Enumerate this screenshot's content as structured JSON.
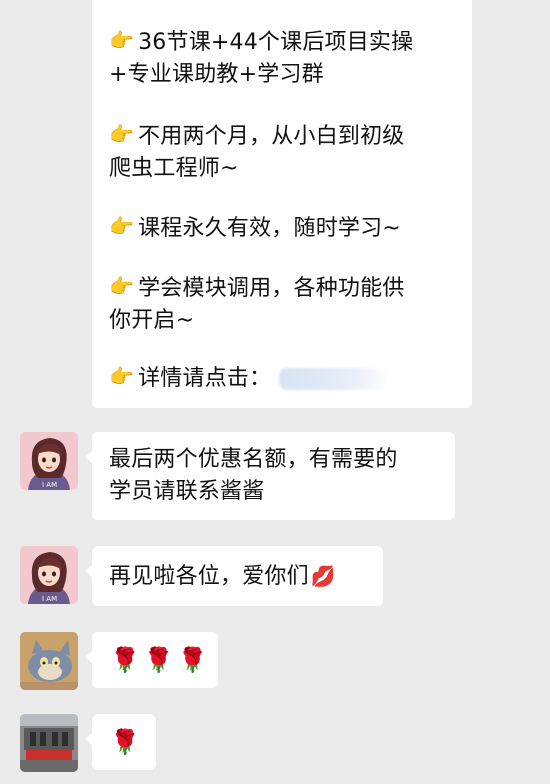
{
  "messages": [
    {
      "sender": "self-truncated",
      "paragraphs": [
        {
          "icon": "👉",
          "lines": [
            "36节课+44个课后项目实操",
            "+专业课助教+学习群"
          ]
        },
        {
          "icon": "👉",
          "lines": [
            "不用两个月，从小白到初级",
            "爬虫工程师~"
          ]
        },
        {
          "icon": "👉",
          "lines": [
            "课程永久有效，随时学习~"
          ]
        },
        {
          "icon": "👉",
          "lines": [
            "学会模块调用，各种功能供",
            "你开启~"
          ]
        },
        {
          "icon": "👉",
          "lines": [
            "详情请点击："
          ]
        }
      ]
    },
    {
      "sender": "anime-avatar",
      "lines": [
        "最后两个优惠名额，有需要的",
        "学员请联系酱酱"
      ]
    },
    {
      "sender": "anime-avatar",
      "text": "再见啦各位，爱你们",
      "emoji": "💋"
    },
    {
      "sender": "tom-cat-avatar",
      "emoji": "🌹🌹🌹"
    },
    {
      "sender": "building-avatar",
      "emoji": "🌹"
    }
  ]
}
